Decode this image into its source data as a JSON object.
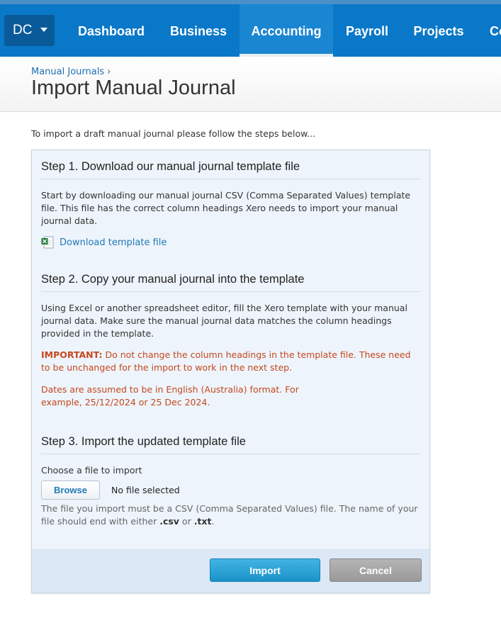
{
  "nav": {
    "org_label": "DC",
    "items": [
      {
        "label": "Dashboard"
      },
      {
        "label": "Business"
      },
      {
        "label": "Accounting"
      },
      {
        "label": "Payroll"
      },
      {
        "label": "Projects"
      },
      {
        "label": "Co"
      }
    ],
    "active_item": "Accounting"
  },
  "breadcrumb": {
    "parent": "Manual Journals",
    "separator": "›"
  },
  "page_title": "Import Manual Journal",
  "intro_text": "To import a draft manual journal please follow the steps below...",
  "step1": {
    "heading": "Step 1. Download our manual journal template file",
    "body": "Start by downloading our manual journal CSV (Comma Separated Values) template file. This file has the correct column headings Xero needs to import your manual journal data.",
    "download_link": "Download template file"
  },
  "step2": {
    "heading": "Step 2. Copy your manual journal into the template",
    "body": "Using Excel or another spreadsheet editor, fill the Xero template with your manual journal data. Make sure the manual journal data matches the column headings provided in the template.",
    "important_label": "IMPORTANT:",
    "important_text": " Do not change the column headings in the template file. These need to be unchanged for the import to work in the next step.",
    "dates_note": "Dates are assumed to be in English (Australia) format. For example, 25/12/2024 or 25 Dec 2024."
  },
  "step3": {
    "heading": "Step 3. Import the updated template file",
    "choose_label": "Choose a file to import",
    "browse_label": "Browse",
    "file_status": "No file selected",
    "help_prefix": "The file you import must be a CSV (Comma Separated Values) file. The name of your file should end with either ",
    "ext_csv": ".csv",
    "help_or": " or ",
    "ext_txt": ".txt",
    "help_suffix": "."
  },
  "footer": {
    "import_label": "Import",
    "cancel_label": "Cancel"
  },
  "colors": {
    "nav_bg": "#0a78c8",
    "org_bg": "#0a5a9a",
    "link": "#1f7ab8",
    "warning": "#c4481e",
    "panel_bg": "#eef4fb",
    "import_button": "#2aa2d6",
    "cancel_button": "#a7a7a7"
  },
  "icons": {
    "org_caret": "caret-down-icon",
    "excel_file": "excel-file-icon"
  }
}
